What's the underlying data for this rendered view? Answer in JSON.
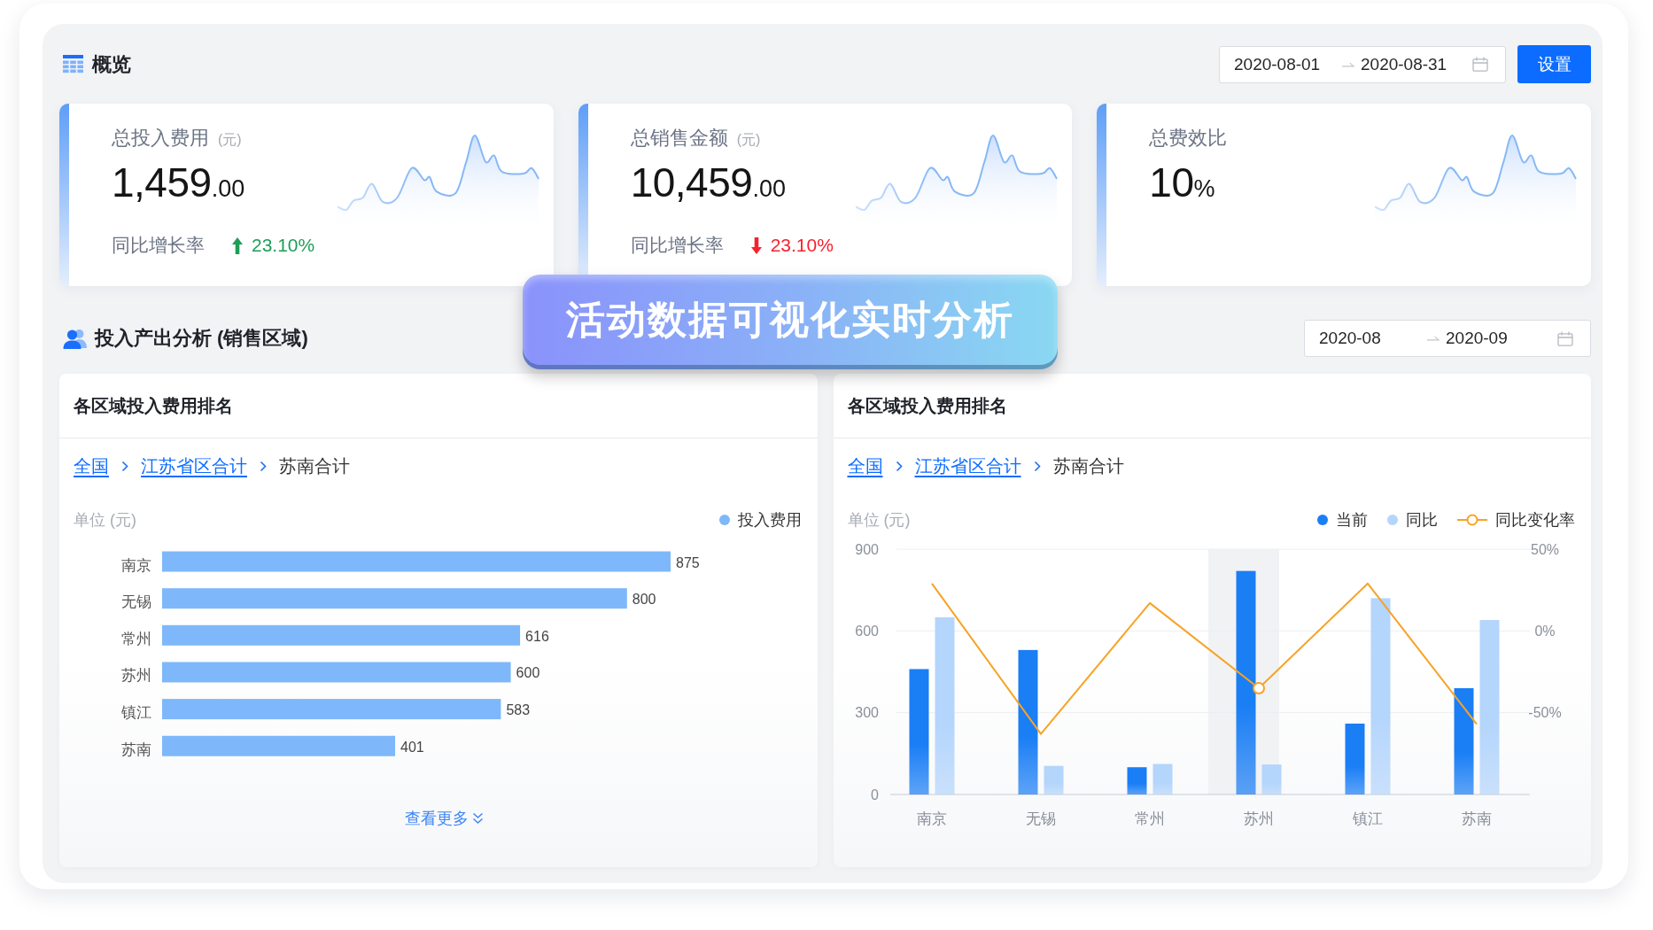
{
  "overview": {
    "title": "概览",
    "date_range": {
      "start": "2020-08-01",
      "end": "2020-08-31"
    },
    "settings_button": "设置"
  },
  "kpi_cards": [
    {
      "title": "总投入费用",
      "unit": "(元)",
      "value": "1,459",
      "value_suffix": ".00",
      "growth": {
        "label": "同比增长率",
        "rising": true,
        "value": "23.10%"
      }
    },
    {
      "title": "总销售金额",
      "unit": "(元)",
      "value": "10,459",
      "value_suffix": ".00",
      "growth": {
        "label": "同比增长率",
        "rising": false,
        "value": "23.10%"
      }
    },
    {
      "title": "总费效比",
      "value": "10",
      "value_suffix": "%"
    }
  ],
  "banner": {
    "text": "活动数据可视化实时分析"
  },
  "analysis": {
    "title": "投入产出分析 (销售区域)",
    "date_range": {
      "start": "2020-08",
      "end": "2020-09"
    },
    "panels": [
      {
        "title": "各区域投入费用排名",
        "breadcrumb": [
          {
            "label": "全国",
            "kind": "link"
          },
          {
            "label": "江苏省区合计",
            "kind": "link"
          },
          {
            "label": "苏南合计",
            "kind": "current"
          }
        ],
        "unit_label": "单位 (元)",
        "chart_data": {
          "type": "bar",
          "orientation": "horizontal",
          "categories": [
            "南京",
            "无锡",
            "常州",
            "苏州",
            "镇江",
            "苏南"
          ],
          "series": [
            {
              "name": "投入费用",
              "color": "#7eb8fa",
              "values": [
                875,
                800,
                616,
                600,
                583,
                401
              ]
            }
          ],
          "data_labels": true
        },
        "more_link": "查看更多"
      },
      {
        "title": "各区域投入费用排名",
        "breadcrumb": [
          {
            "label": "全国",
            "kind": "link"
          },
          {
            "label": "江苏省区合计",
            "kind": "link"
          },
          {
            "label": "苏南合计",
            "kind": "current"
          }
        ],
        "unit_label": "单位 (元)",
        "chart_data": {
          "type": "bar",
          "orientation": "vertical",
          "categories": [
            "南京",
            "无锡",
            "常州",
            "苏州",
            "镇江",
            "苏南"
          ],
          "series": [
            {
              "name": "当前",
              "type": "bar",
              "color": "#1a7ef5",
              "values": [
                460,
                530,
                100,
                820,
                260,
                390
              ]
            },
            {
              "name": "同比",
              "type": "bar",
              "color": "#b4d5fc",
              "values": [
                650,
                105,
                112,
                110,
                720,
                640
              ]
            },
            {
              "name": "同比变化率",
              "type": "line",
              "axis": "y2",
              "color": "#f7a325",
              "values": [
                29,
                -63,
                17,
                -35,
                29,
                -57
              ]
            }
          ],
          "ylim": [
            0,
            900
          ],
          "yticks": [
            0,
            300,
            600,
            900
          ],
          "y2lim": [
            -100,
            50
          ],
          "y2ticks": [
            {
              "value": -50,
              "label": "-50%"
            },
            {
              "value": 0,
              "label": "0%"
            },
            {
              "value": 50,
              "label": "50%"
            }
          ],
          "bands": [
            {
              "axis": "x",
              "from": "苏州",
              "to": "苏州"
            }
          ]
        }
      }
    ]
  }
}
